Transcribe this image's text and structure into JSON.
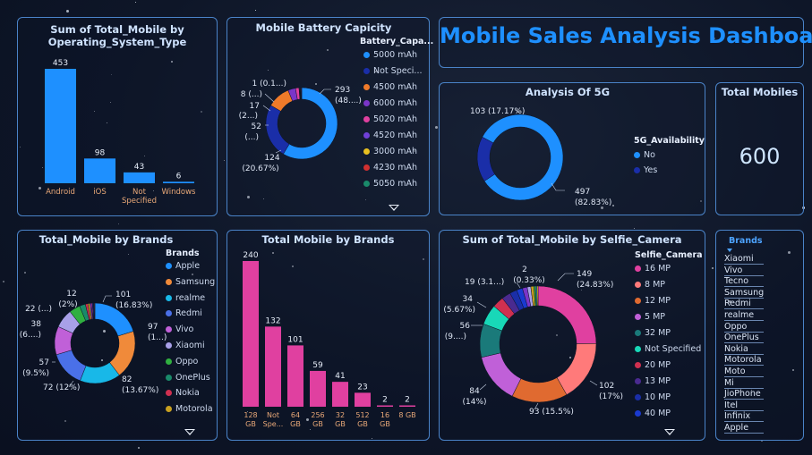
{
  "dashboard_title": "Mobile Sales Analysis Dashboard",
  "colors": {
    "bar_blue": "#1e90ff",
    "bar_pink": "#e040a0",
    "panel_border": "#4a83c8",
    "title": "#cfe3ff"
  },
  "total_mobiles": {
    "title": "Total Mobiles",
    "value": "600"
  },
  "chart_data": [
    {
      "type": "bar",
      "title": "Sum of Total_Mobile by Operating_System_Type",
      "categories": [
        "Android",
        "iOS",
        "Not Specified",
        "Windows"
      ],
      "values": [
        453,
        98,
        43,
        6
      ],
      "value_labels": [
        "453",
        "98",
        "43",
        "6"
      ],
      "category_labels": [
        [
          "Android"
        ],
        [
          "iOS"
        ],
        [
          "Not",
          "Specified"
        ],
        [
          "Windows"
        ]
      ]
    },
    {
      "type": "pie",
      "title": "Mobile Battery Capicity",
      "legend_title": "Battery_Capa...",
      "legend": [
        "5000 mAh",
        "Not Speci...",
        "4500 mAh",
        "6000 mAh",
        "5020 mAh",
        "4520 mAh",
        "3000 mAh",
        "4230 mAh",
        "5050 mAh"
      ],
      "values": [
        293,
        124,
        52,
        17,
        8,
        1,
        1,
        1,
        1,
        1,
        1
      ],
      "data_labels": [
        "293",
        "(48....)",
        "124",
        "(20.67%)",
        "52",
        "(...)",
        "17",
        "(2...)",
        "8 (...)",
        "1 (0.1...)"
      ]
    },
    {
      "type": "pie",
      "title": "Analysis Of 5G",
      "legend_title": "5G_Availability",
      "legend": [
        "No",
        "Yes"
      ],
      "values": [
        497,
        103
      ],
      "data_labels": [
        "497",
        "(82.83%)",
        "103 (17.17%)"
      ]
    },
    {
      "type": "pie",
      "title": "Total_Mobile by Brands",
      "legend_title": "Brands",
      "legend": [
        "Apple",
        "Samsung",
        "realme",
        "Redmi",
        "Vivo",
        "Xiaomi",
        "Oppo",
        "OnePlus",
        "Nokia",
        "Motorola"
      ],
      "values": [
        101,
        97,
        82,
        72,
        57,
        38,
        22,
        12,
        5,
        4,
        3,
        2,
        2,
        1,
        1,
        1
      ],
      "data_labels": [
        "101",
        "(16.83%)",
        "97",
        "(1...)",
        "82",
        "(13.67%)",
        "72 (12%)",
        "57",
        "(9.5%)",
        "38",
        "(6....)",
        "22 (...)",
        "12",
        "(2%)"
      ]
    },
    {
      "type": "bar",
      "title": "Total Mobile by Brands",
      "categories": [
        "128 GB",
        "Not Specified",
        "64 GB",
        "256 GB",
        "32 GB",
        "512 GB",
        "16 GB",
        "8 GB"
      ],
      "values": [
        240,
        132,
        101,
        59,
        41,
        23,
        2,
        2
      ],
      "value_labels": [
        "240",
        "132",
        "101",
        "59",
        "41",
        "23",
        "2",
        "2"
      ],
      "category_labels": [
        [
          "128",
          "GB"
        ],
        [
          "Not",
          "Spe..."
        ],
        [
          "64",
          "GB"
        ],
        [
          "256",
          "GB"
        ],
        [
          "32",
          "GB"
        ],
        [
          "512",
          "GB"
        ],
        [
          "16",
          "GB"
        ],
        [
          "8 GB"
        ]
      ]
    },
    {
      "type": "pie",
      "title": "Sum of Total_Mobile by Selfie_Camera",
      "legend_title": "Selfie_Camera",
      "legend": [
        "16 MP",
        "8 MP",
        "12 MP",
        "5 MP",
        "32 MP",
        "Not Specified",
        "20 MP",
        "13 MP",
        "10 MP",
        "40 MP"
      ],
      "values": [
        149,
        102,
        93,
        84,
        56,
        34,
        19,
        15,
        12,
        10,
        8,
        6,
        5,
        3,
        2,
        2
      ],
      "data_labels": [
        "149",
        "(24.83%)",
        "102",
        "(17%)",
        "93 (15.5%)",
        "84",
        "(14%)",
        "56",
        "(9....)",
        "34",
        "(5.67%)",
        "19 (3.1...)",
        "2",
        "(0.33%)"
      ]
    }
  ],
  "brand_slicer": {
    "title": "Brands",
    "items": [
      "Xiaomi",
      "Vivo",
      "Tecno",
      "Samsung",
      "Redmi",
      "realme",
      "Oppo",
      "OnePlus",
      "Nokia",
      "Motorola",
      "Moto",
      "Mi",
      "JioPhone",
      "Itel",
      "Infinix",
      "Apple"
    ]
  }
}
